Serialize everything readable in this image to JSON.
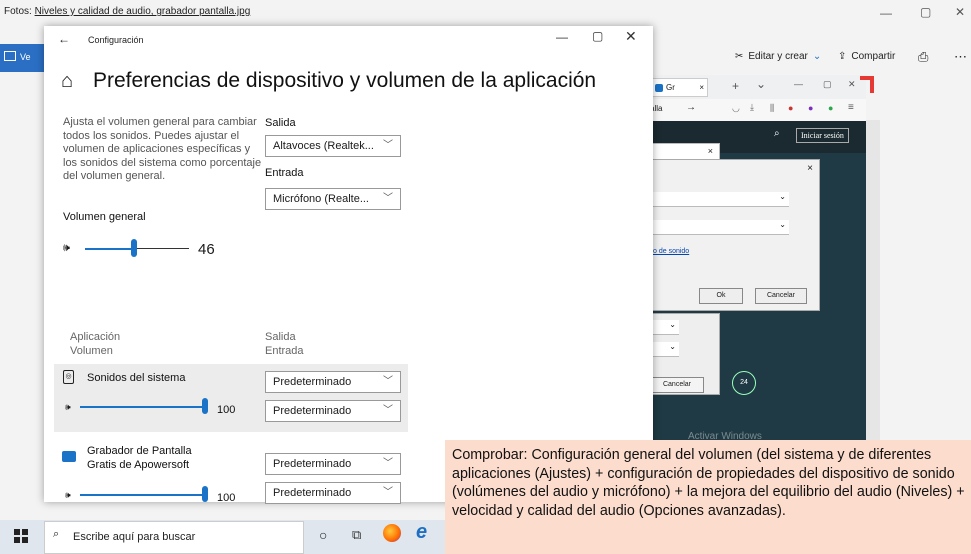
{
  "photos": {
    "title_prefix": "Fotos: ",
    "title_file": "Niveles y calidad de audio, grabador pantalla.jpg",
    "view_label": "Ve",
    "edit_label": "Editar y crear",
    "share_label": "Compartir",
    "min": "—",
    "max": "▢",
    "close": "✕"
  },
  "browser": {
    "tab_label": "Gr",
    "tab_close": "×",
    "new_tab": "+",
    "dropdown": "⌄",
    "addr_fragment": "alla",
    "login": "Iniciar sesión",
    "dialog_link": "o de sonido",
    "ok": "Ok",
    "cancel": "Cancelar",
    "cancel2": "Cancelar",
    "badge": "24",
    "watermark": "Activar Windows"
  },
  "settings": {
    "window_title": "Configuración",
    "heading": "Preferencias de dispositivo y volumen de la aplicación",
    "description": "Ajusta el volumen general para cambiar todos los sonidos. Puedes ajustar el volumen de aplicaciones específicas y los sonidos del sistema como porcentaje del volumen general.",
    "volume_label": "Volumen general",
    "volume_value": "46",
    "volume_level": 0.46,
    "output_label": "Salida",
    "output_value": "Altavoces (Realtek...",
    "input_label": "Entrada",
    "input_value": "Micrófono (Realte...",
    "col_app": "Aplicación",
    "col_volume": "Volumen",
    "col_output": "Salida",
    "col_input": "Entrada",
    "apps": [
      {
        "name": "Sonidos del sistema",
        "volume": "100",
        "level": 1.0,
        "output": "Predeterminado",
        "input": "Predeterminado"
      },
      {
        "name_line1": "Grabador de Pantalla",
        "name_line2": "Gratis de Apowersoft",
        "volume": "100",
        "level": 1.0,
        "output": "Predeterminado",
        "input": "Predeterminado"
      }
    ]
  },
  "taskbar": {
    "search_placeholder": "Escribe aquí para buscar"
  },
  "note": {
    "text": "Comprobar: Configuración general del volumen (del sistema y de diferentes aplicaciones (Ajustes) + configuración de propiedades del dispositivo de sonido (volúmenes del audio y micrófono) + la mejora del equilibrio del audio (Niveles) + velocidad y calidad del audio (Opciones avanzadas)."
  },
  "colors": {
    "accent": "#1a73c7",
    "note_bg": "#fbdccd",
    "browser_bg": "#1f3a44"
  }
}
